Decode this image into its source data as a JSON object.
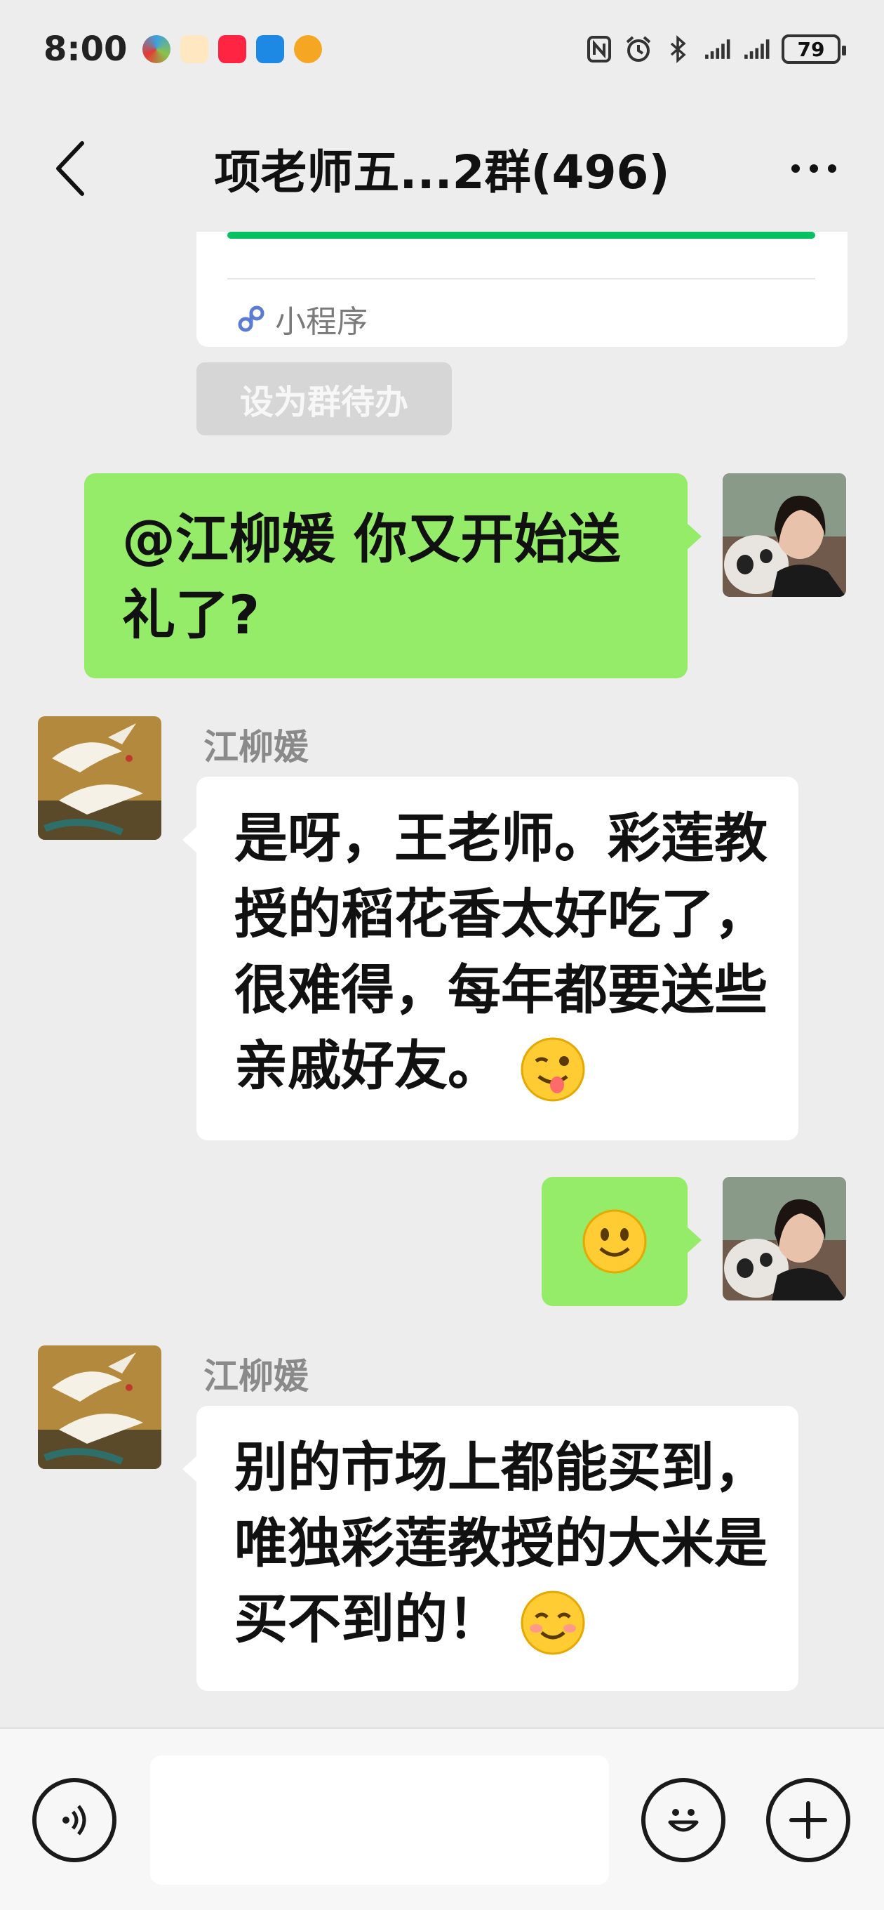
{
  "status_bar": {
    "time": "8:00",
    "battery": "79",
    "app_icons": [
      "china-mobile-icon",
      "app-icon-orange",
      "xiaohongshu-icon",
      "app-icon-blue",
      "weibo-icon"
    ],
    "status_icons": [
      "nfc-icon",
      "alarm-icon",
      "bluetooth-icon",
      "signal-icon",
      "signal-icon"
    ]
  },
  "nav": {
    "title": "项老师五...2群(496)"
  },
  "mini_program": {
    "label": "小程序"
  },
  "todo_chip": {
    "label": "设为群待办"
  },
  "messages": [
    {
      "sender": "me",
      "text": "@江柳媛  你又开始送礼了?"
    },
    {
      "sender": "江柳媛",
      "name": "江柳媛",
      "text": "是呀，王老师。彩莲教授的稻花香太好吃了，很难得，每年都要送些亲戚好友。",
      "emoji": "wink-tongue-emoji"
    },
    {
      "sender": "me",
      "text": "",
      "emoji": "smile-emoji"
    },
    {
      "sender": "江柳媛",
      "name": "江柳媛",
      "text": "别的市场上都能买到，唯独彩莲教授的大米是买不到的！",
      "emoji": "blush-emoji"
    }
  ],
  "colors": {
    "my_bubble": "#95ec69",
    "their_bubble": "#ffffff",
    "background": "#ededed",
    "accent_green": "#07c160"
  }
}
